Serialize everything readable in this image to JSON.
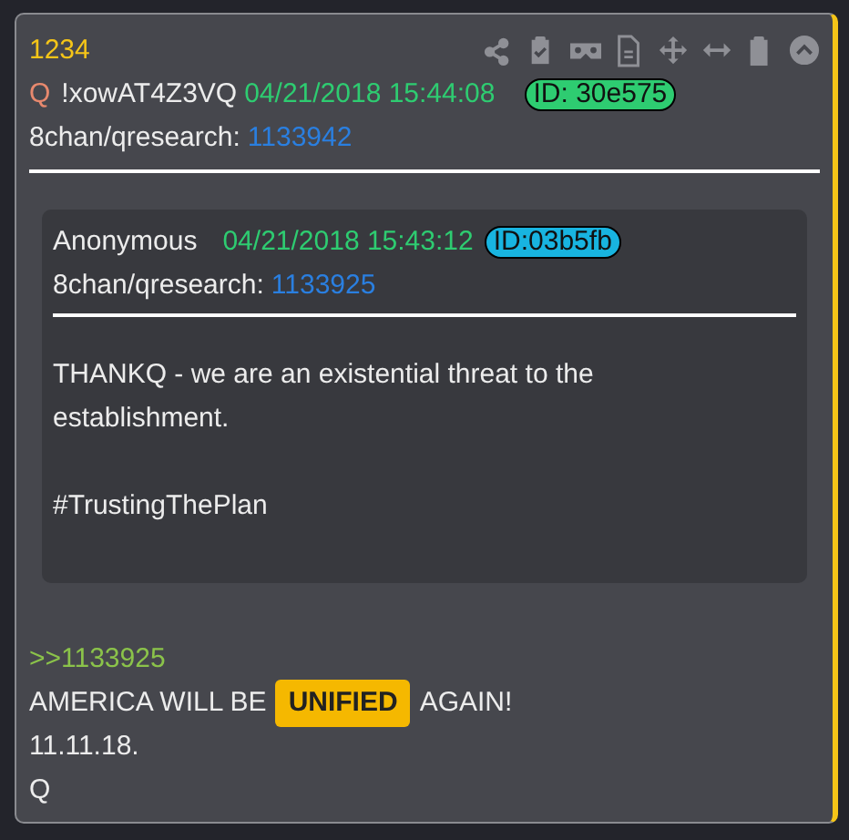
{
  "post": {
    "number": "1234",
    "tripcode_name": "Q",
    "tripcode": "!xowAT4Z3VQ",
    "timestamp": "04/21/2018 15:44:08",
    "id_badge": {
      "text": "ID: 30e575",
      "color": "#2ecc71"
    },
    "board": "8chan/qresearch:",
    "post_link": "1133942",
    "quote": {
      "name": "Anonymous",
      "timestamp": "04/21/2018 15:43:12",
      "id_badge": {
        "text": "ID:03b5fb",
        "color": "#18b4e0"
      },
      "board": "8chan/qresearch:",
      "post_link": "1133925",
      "paragraphs": [
        "THANKQ - we are an existential threat to the establishment.",
        "#TrustingThePlan"
      ]
    },
    "reply_link": ">>1133925",
    "lines": [
      [
        {
          "kind": "text",
          "text": "AMERICA WILL BE"
        },
        {
          "kind": "highlight",
          "text": "UNIFIED"
        },
        {
          "kind": "text",
          "text": "AGAIN!"
        }
      ],
      [
        {
          "kind": "text",
          "text": "11.11.18."
        }
      ],
      [
        {
          "kind": "text",
          "text": "Q"
        }
      ]
    ]
  }
}
